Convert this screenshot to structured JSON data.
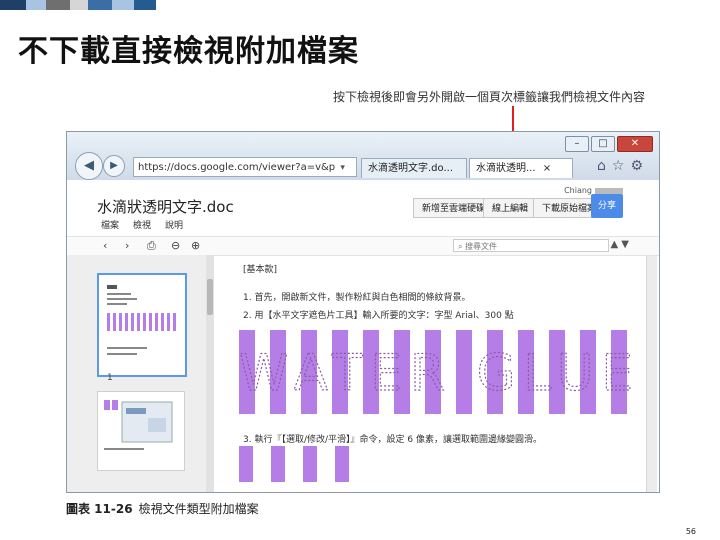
{
  "slide": {
    "title": "不下載直接檢視附加檔案",
    "callout": "按下檢視後即會另外開啟一個頁次標籤讓我們檢視文件內容",
    "caption_label": "圖表 11-26",
    "caption_text": "檢視文件類型附加檔案",
    "page_number": "56",
    "deco_colors": [
      "#1e3f66",
      "#3b6ea5",
      "#a9c4e2",
      "#6f6f6f",
      "#d6d6d6",
      "#245c8f"
    ]
  },
  "browser": {
    "address": "https://docs.google.com/viewer?a=v&p",
    "address_icons": "▾ 🔒 ↻ ×",
    "tabs": [
      {
        "label": "水滴透明文字.do..."
      },
      {
        "label": "水滴狀透明..."
      }
    ],
    "tab_close": "×",
    "window_buttons": {
      "minimize": "–",
      "maximize": "□",
      "close": "✕"
    },
    "nav": {
      "back": "◀",
      "forward": "▶"
    },
    "icons": [
      "home-icon",
      "star-icon",
      "gear-icon"
    ]
  },
  "viewer": {
    "user": "Chiang",
    "doc_name": "水滴狀透明文字.doc",
    "menus": [
      "檔案",
      "檢視",
      "說明"
    ],
    "buttons": [
      "新增至雲端硬碟",
      "線上編輯",
      "下載原始檔案"
    ],
    "share": "分享",
    "search_placeholder": "搜尋文件",
    "page_label": "1",
    "toolbar_icons": [
      "prev-page-icon",
      "next-page-icon",
      "print-icon",
      "zoom-out-icon",
      "zoom-in-icon"
    ]
  },
  "document": {
    "heading": "[基本款]",
    "steps": [
      "1. 首先，開啟新文件，製作粉紅與白色相間的條紋背景。",
      "2. 用【水平文字遮色片工具】輸入所要的文字：字型 Arial、300 點",
      "3. 執行『【選取/修改/平滑】』命令，設定 6 像素，讓選取範圍邊緣變圓滑。"
    ],
    "big_text": "WATER GLUE",
    "stripe_color": "#b57ee6"
  }
}
